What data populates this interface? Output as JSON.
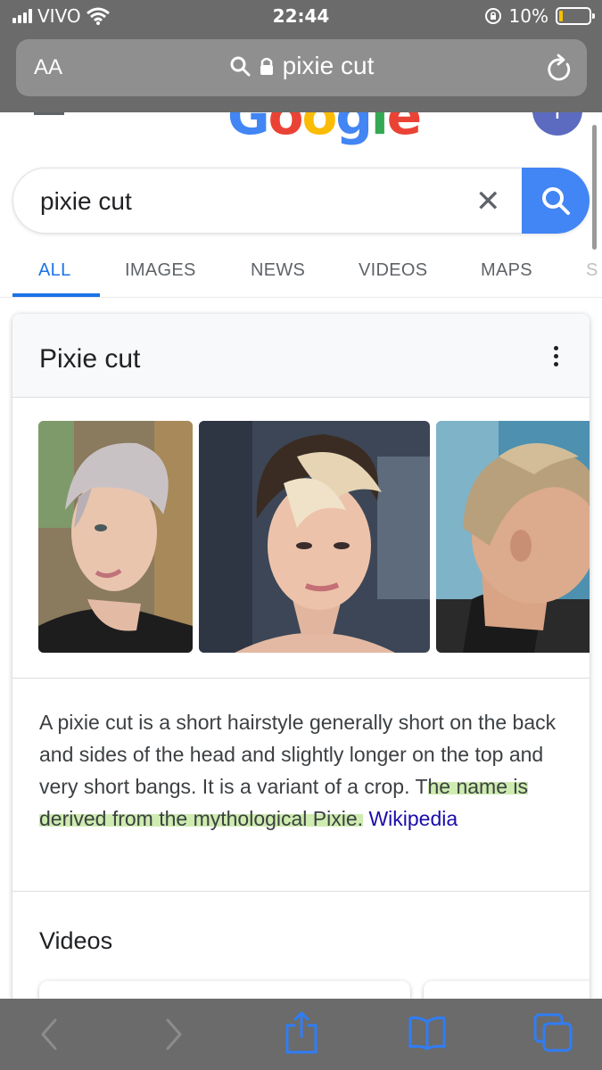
{
  "status_bar": {
    "carrier": "VIVO",
    "time": "22:44",
    "battery": "10%"
  },
  "browser": {
    "text_size_label": "AA",
    "url_text": "pixie cut"
  },
  "search": {
    "query": "pixie cut",
    "clear_symbol": "✕"
  },
  "tabs": [
    {
      "label": "ALL",
      "active": true
    },
    {
      "label": "IMAGES",
      "active": false
    },
    {
      "label": "NEWS",
      "active": false
    },
    {
      "label": "VIDEOS",
      "active": false
    },
    {
      "label": "MAPS",
      "active": false
    },
    {
      "label": "S",
      "active": false
    }
  ],
  "knowledge_panel": {
    "title": "Pixie cut",
    "images": [
      {
        "subject": "woman with platinum pixie cut, side profile"
      },
      {
        "subject": "woman with blonde highlighted pixie cut"
      },
      {
        "subject": "woman with undercut pixie, side view"
      }
    ],
    "description_plain": "A pixie cut is a short hairstyle generally short on the back and sides of the head and slightly longer on the top and very short bangs. It is a variant of a crop. T",
    "description_highlighted": "he name is derived from the mythological Pixie.",
    "source_link": "Wikipedia",
    "videos_heading": "Videos"
  },
  "icons": {
    "account": "T",
    "text_size": "text-size-icon",
    "search": "search-icon",
    "lock": "lock-icon",
    "reload": "reload-icon",
    "back": "back-icon",
    "forward": "forward-icon",
    "share": "share-icon",
    "bookmarks": "bookmarks-icon",
    "tabs": "tabs-icon"
  },
  "colors": {
    "google_blue": "#4285f4",
    "active_tab": "#1a73e8",
    "link": "#1a0dab",
    "highlight": "#bee696",
    "chrome_gray": "#6b6b6b"
  }
}
